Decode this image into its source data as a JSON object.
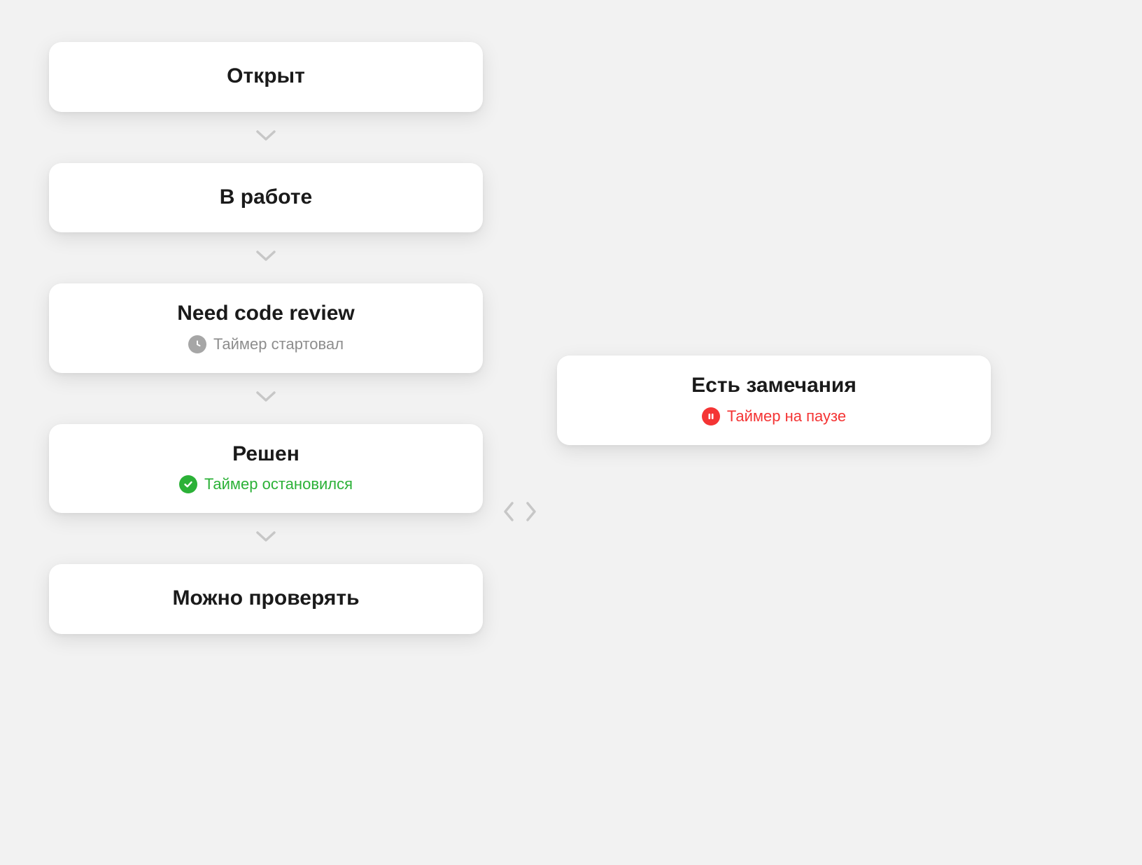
{
  "flow": {
    "steps": [
      {
        "title": "Открыт"
      },
      {
        "title": "В работе"
      },
      {
        "title": "Need code review",
        "subtitle": "Таймер стартовал",
        "status": "started"
      },
      {
        "title": "Решен",
        "subtitle": "Таймер остановился",
        "status": "stopped"
      },
      {
        "title": "Можно проверять"
      }
    ],
    "side": {
      "title": "Есть замечания",
      "subtitle": "Таймер на паузе",
      "status": "paused"
    }
  },
  "colors": {
    "started": "#a6a6a6",
    "stopped": "#2bb137",
    "paused": "#f43434"
  }
}
